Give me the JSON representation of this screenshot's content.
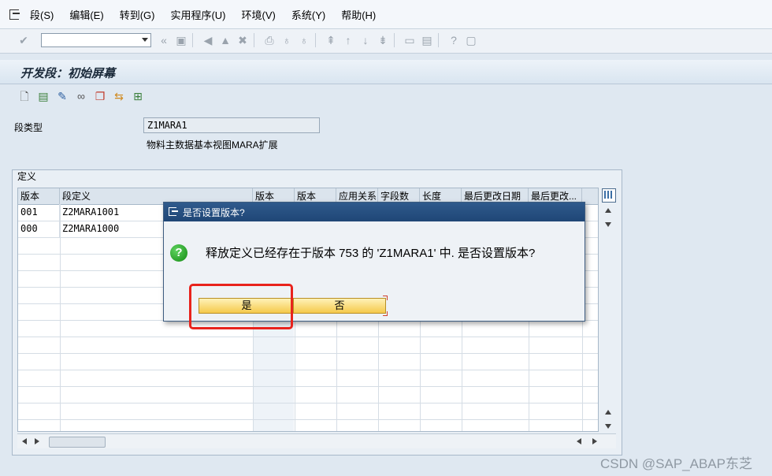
{
  "menu": [
    "段(S)",
    "编辑(E)",
    "转到(G)",
    "实用程序(U)",
    "环境(V)",
    "系统(Y)",
    "帮助(H)"
  ],
  "screen_title": "开发段：初始屏幕",
  "segment": {
    "label": "段类型",
    "value": "Z1MARA1",
    "description": "物料主数据基本视图MARA扩展"
  },
  "group_title": "定义",
  "table": {
    "columns": [
      "版本",
      "段定义",
      "版本",
      "版本",
      "应用关系",
      "字段数",
      "长度",
      "最后更改日期",
      "最后更改..."
    ],
    "rows": [
      {
        "version": "001",
        "definition": "Z2MARA1001"
      },
      {
        "version": "000",
        "definition": "Z2MARA1000"
      }
    ]
  },
  "dialog": {
    "title": "是否设置版本?",
    "message": "释放定义已经存在于版本 753 的 'Z1MARA1' 中. 是否设置版本?",
    "yes_label": "是",
    "no_label": "否"
  },
  "watermark": "CSDN @SAP_ABAP东芝",
  "colors": {
    "dialog_title_bg": "#1f4676",
    "button_bg": "#f5c94b",
    "highlight": "#e8231c",
    "question_icon": "#138a13"
  }
}
